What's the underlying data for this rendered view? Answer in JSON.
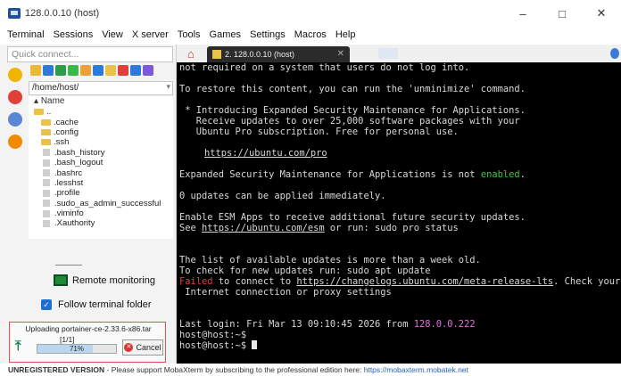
{
  "window": {
    "title": "128.0.0.10 (host)",
    "controls": [
      "–",
      "□",
      "✕"
    ]
  },
  "menu": [
    "Terminal",
    "Sessions",
    "View",
    "X server",
    "Tools",
    "Games",
    "Settings",
    "Macros",
    "Help"
  ],
  "sidebar": {
    "quick_connect_placeholder": "Quick connect...",
    "path": "/home/host/",
    "tree_header": "Name",
    "tree_items": [
      {
        "name": "..",
        "type": "folder"
      },
      {
        "name": ".cache",
        "type": "folder"
      },
      {
        "name": ".config",
        "type": "folder"
      },
      {
        "name": ".ssh",
        "type": "folder"
      },
      {
        "name": ".bash_history",
        "type": "file"
      },
      {
        "name": ".bash_logout",
        "type": "file"
      },
      {
        "name": ".bashrc",
        "type": "file"
      },
      {
        "name": ".lesshst",
        "type": "file"
      },
      {
        "name": ".profile",
        "type": "file"
      },
      {
        "name": ".sudo_as_admin_successful",
        "type": "file"
      },
      {
        "name": ".viminfo",
        "type": "file"
      },
      {
        "name": ".Xauthority",
        "type": "file"
      }
    ],
    "remote_monitoring": "Remote monitoring",
    "follow_folder": "Follow terminal folder",
    "upload": {
      "label": "Uploading portainer-ce-2.33.6-x86.tar",
      "count": "[1/1]",
      "progress_text": "71%",
      "progress": 0.71,
      "cancel": "Cancel"
    }
  },
  "tabs": {
    "active_label": "2. 128.0.0.10 (host)"
  },
  "terminal": {
    "l1": "not required on a system that users do not log into.",
    "l2": "To restore this content, you can run the 'unminimize' command.",
    "l3": " * Introducing Expanded Security Maintenance for Applications.",
    "l4": "   Receive updates to over 25,000 software packages with your",
    "l5": "   Ubuntu Pro subscription. Free for personal use.",
    "l6": "https://ubuntu.com/pro",
    "l7a": "Expanded Security Maintenance for Applications is not ",
    "l7b": "enabled",
    "l7c": ".",
    "l8": "0 updates can be applied immediately.",
    "l9": "Enable ESM Apps to receive additional future security updates.",
    "l10a": "See ",
    "l10b": "https://ubuntu.com/esm",
    "l10c": " or run: sudo pro status",
    "l11": "The list of available updates is more than a week old.",
    "l12": "To check for new updates run: sudo apt update",
    "l13a": "Failed",
    "l13b": " to connect to ",
    "l13c": "https://changelogs.ubuntu.com/meta-release-lts",
    "l13d": ". Check your",
    "l14": " Internet connection or proxy settings",
    "l15a": "Last login:",
    "l15b": " Fri Mar 13 09:10:45 2026 from ",
    "l15c": "128.0.0.222",
    "l16": "host@host:~$",
    "l17": "host@host:~$ "
  },
  "status": {
    "strong": "UNREGISTERED VERSION",
    "text": "  -  Please support MobaXterm by subscribing to the professional edition here:  ",
    "link": "https://mobaxterm.mobatek.net"
  },
  "colors": {
    "terminal_bg": "#000000",
    "accent_green": "#3ec43e",
    "error_red": "#e0403a",
    "host_magenta": "#e070e0"
  }
}
